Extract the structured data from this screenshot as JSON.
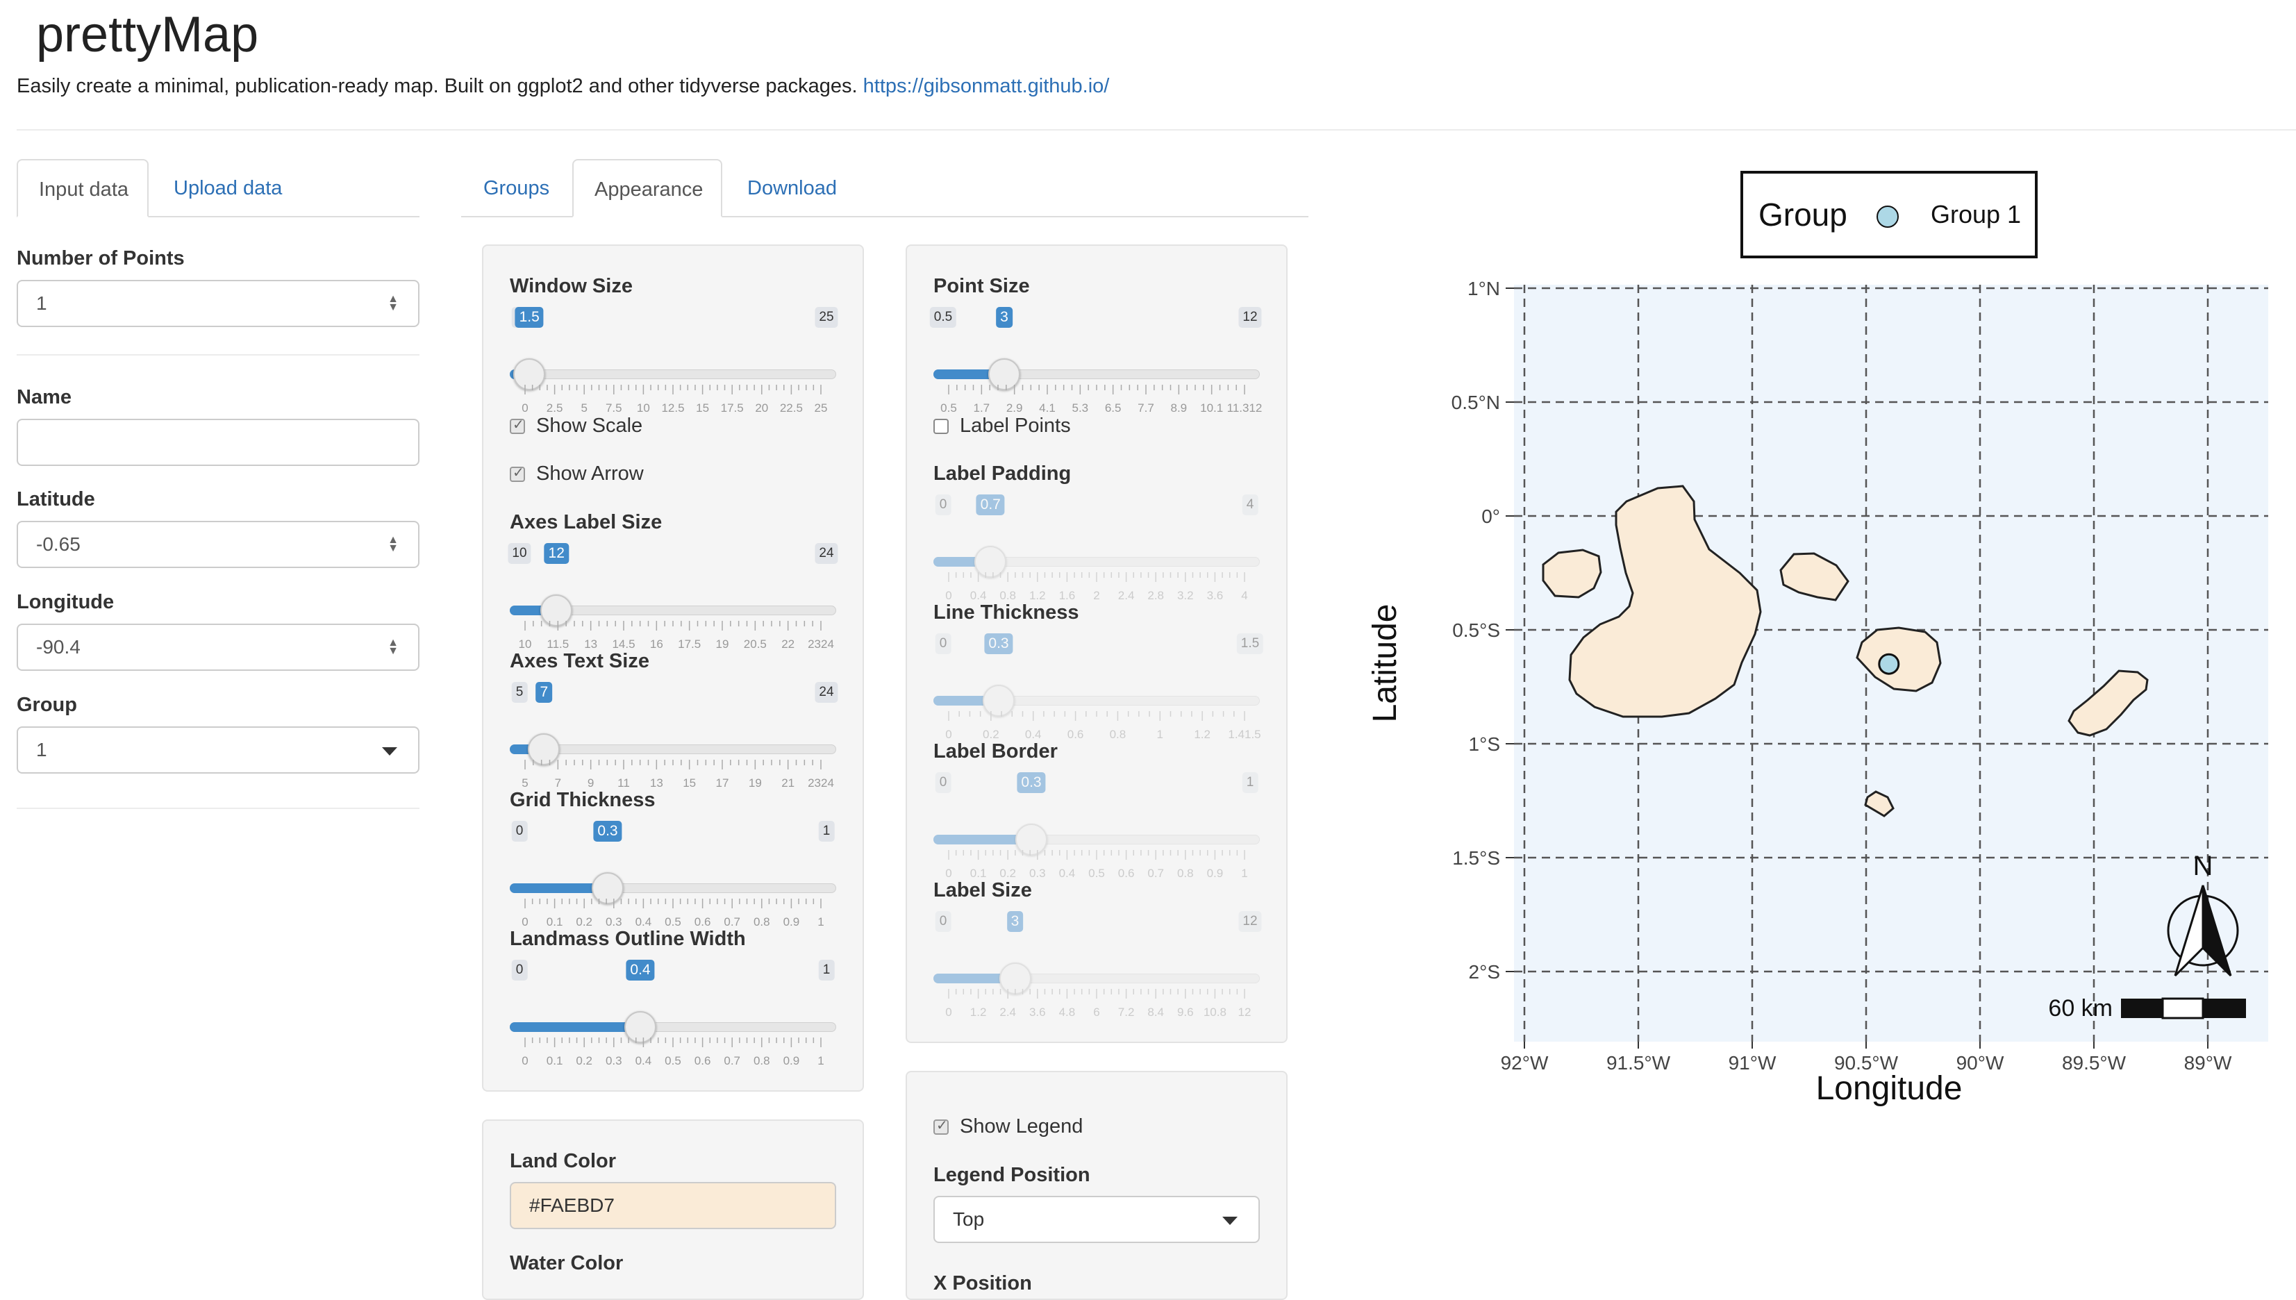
{
  "app": {
    "title": "prettyMap",
    "tagline": "Easily create a minimal, publication-ready map. Built on ggplot2 and other tidyverse packages.",
    "link_text": "https://gibsonmatt.github.io/"
  },
  "left_tabs": [
    {
      "label": "Input data",
      "active": true
    },
    {
      "label": "Upload data",
      "active": false
    }
  ],
  "form": {
    "num_points": {
      "label": "Number of Points",
      "value": "1"
    },
    "name": {
      "label": "Name",
      "value": ""
    },
    "latitude": {
      "label": "Latitude",
      "value": "-0.65"
    },
    "longitude": {
      "label": "Longitude",
      "value": "-90.4"
    },
    "group": {
      "label": "Group",
      "value": "1"
    }
  },
  "center_tabs": [
    {
      "label": "Groups",
      "active": false
    },
    {
      "label": "Appearance",
      "active": true
    },
    {
      "label": "Download",
      "active": false
    }
  ],
  "col1": {
    "window_size": {
      "label": "Window Size",
      "min": "0",
      "max": "25",
      "value": "1.5",
      "fraction": 0.06,
      "ticks": [
        "0",
        "2.5",
        "5",
        "7.5",
        "10",
        "12.5",
        "15",
        "17.5",
        "20",
        "22.5",
        "25"
      ]
    },
    "show_scale": {
      "label": "Show Scale",
      "checked": true
    },
    "show_arrow": {
      "label": "Show Arrow",
      "checked": true
    },
    "axes_label_size": {
      "label": "Axes Label Size",
      "min": "10",
      "max": "24",
      "value": "12",
      "fraction": 0.143,
      "ticks": [
        "10",
        "11.5",
        "13",
        "14.5",
        "16",
        "17.5",
        "19",
        "20.5",
        "22",
        "2324"
      ]
    },
    "axes_text_size": {
      "label": "Axes Text Size",
      "min": "5",
      "max": "24",
      "value": "7",
      "fraction": 0.105,
      "ticks": [
        "5",
        "7",
        "9",
        "11",
        "13",
        "15",
        "17",
        "19",
        "21",
        "2324"
      ]
    },
    "grid_thickness": {
      "label": "Grid Thickness",
      "min": "0",
      "max": "1",
      "value": "0.3",
      "fraction": 0.3,
      "ticks": [
        "0",
        "0.1",
        "0.2",
        "0.3",
        "0.4",
        "0.5",
        "0.6",
        "0.7",
        "0.8",
        "0.9",
        "1"
      ]
    },
    "landmass_outline": {
      "label": "Landmass Outline Width",
      "min": "0",
      "max": "1",
      "value": "0.4",
      "fraction": 0.4,
      "ticks": [
        "0",
        "0.1",
        "0.2",
        "0.3",
        "0.4",
        "0.5",
        "0.6",
        "0.7",
        "0.8",
        "0.9",
        "1"
      ]
    }
  },
  "col2": {
    "point_size": {
      "label": "Point Size",
      "min": "0.5",
      "max": "12",
      "value": "3",
      "fraction": 0.217,
      "ticks": [
        "0.5",
        "1.7",
        "2.9",
        "4.1",
        "5.3",
        "6.5",
        "7.7",
        "8.9",
        "10.1",
        "11.312"
      ]
    },
    "label_points": {
      "label": "Label Points",
      "checked": false
    },
    "label_padding": {
      "label": "Label Padding",
      "min": "0",
      "max": "4",
      "value": "0.7",
      "fraction": 0.175,
      "ticks": [
        "0",
        "0.4",
        "0.8",
        "1.2",
        "1.6",
        "2",
        "2.4",
        "2.8",
        "3.2",
        "3.6",
        "4"
      ]
    },
    "line_thickness": {
      "label": "Line Thickness",
      "min": "0",
      "max": "1.5",
      "value": "0.3",
      "fraction": 0.2,
      "ticks": [
        "0",
        "0.2",
        "0.4",
        "0.6",
        "0.8",
        "1",
        "1.2",
        "1.41.5"
      ]
    },
    "label_border": {
      "label": "Label Border",
      "min": "0",
      "max": "1",
      "value": "0.3",
      "fraction": 0.3,
      "ticks": [
        "0",
        "0.1",
        "0.2",
        "0.3",
        "0.4",
        "0.5",
        "0.6",
        "0.7",
        "0.8",
        "0.9",
        "1"
      ]
    },
    "label_size": {
      "label": "Label Size",
      "min": "0",
      "max": "12",
      "value": "3",
      "fraction": 0.25,
      "ticks": [
        "0",
        "1.2",
        "2.4",
        "3.6",
        "4.8",
        "6",
        "7.2",
        "8.4",
        "9.6",
        "10.8",
        "12"
      ]
    }
  },
  "colors_panel": {
    "land_color": {
      "label": "Land Color",
      "value": "#FAEBD7"
    },
    "water_color": {
      "label": "Water Color"
    }
  },
  "legend_panel": {
    "show_legend": {
      "label": "Show Legend",
      "checked": true
    },
    "legend_position": {
      "label": "Legend Position",
      "value": "Top"
    },
    "x_position": {
      "label": "X Position"
    }
  },
  "map": {
    "legend_title": "Group",
    "legend_item": "Group 1",
    "xlabel": "Longitude",
    "ylabel": "Latitude",
    "x_ticks": [
      "92°W",
      "91.5°W",
      "91°W",
      "90.5°W",
      "90°W",
      "89.5°W",
      "89°W"
    ],
    "y_ticks": [
      "1°N",
      "0.5°N",
      "0°",
      "0.5°S",
      "1°S",
      "1.5°S",
      "2°S"
    ],
    "north_label": "N",
    "scale_label": "60 km",
    "colors": {
      "land": "#FAEBD7",
      "water": "#EEF5FC",
      "point": "#ADD8E6"
    },
    "point": {
      "lon": -90.4,
      "lat": -0.65
    }
  }
}
